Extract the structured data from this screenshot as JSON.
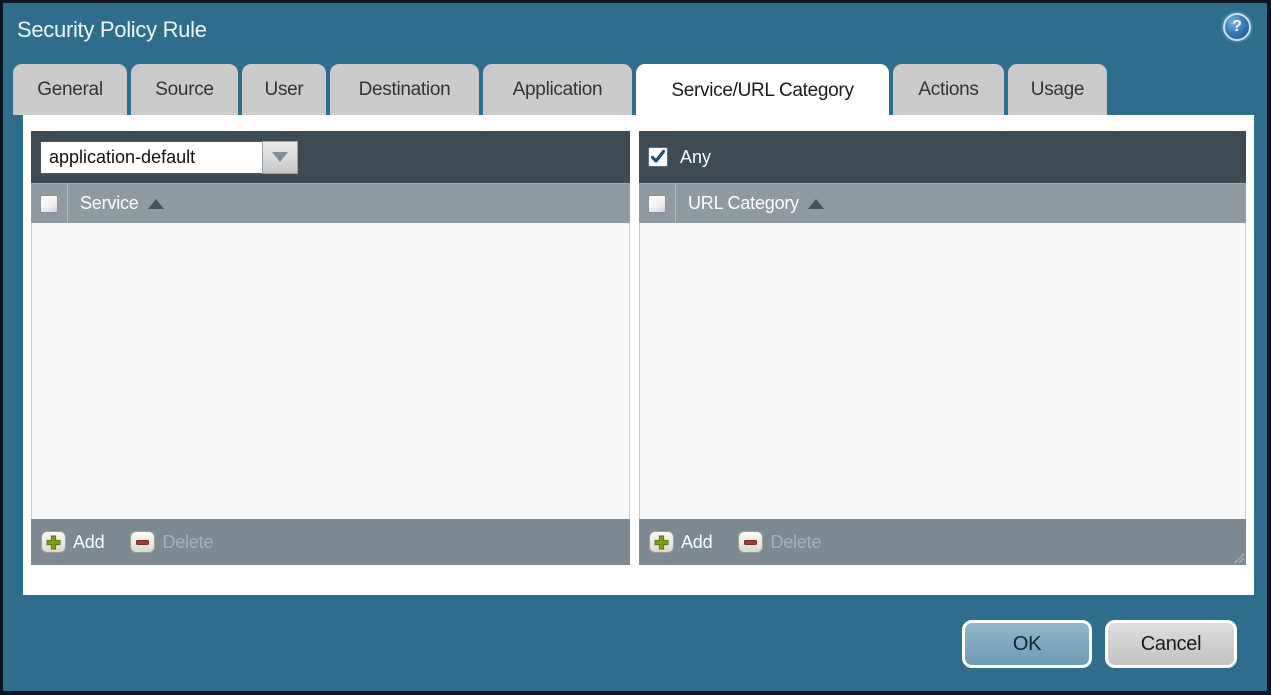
{
  "dialog": {
    "title": "Security Policy Rule"
  },
  "help": {
    "glyph": "?"
  },
  "tabs": [
    {
      "label": "General",
      "active": false
    },
    {
      "label": "Source",
      "active": false
    },
    {
      "label": "User",
      "active": false
    },
    {
      "label": "Destination",
      "active": false
    },
    {
      "label": "Application",
      "active": false
    },
    {
      "label": "Service/URL Category",
      "active": true
    },
    {
      "label": "Actions",
      "active": false
    },
    {
      "label": "Usage",
      "active": false
    }
  ],
  "service_panel": {
    "dropdown_value": "application-default",
    "column_header": "Service",
    "sort_direction": "ascending",
    "select_all_checked": false,
    "rows": [],
    "add_label": "Add",
    "delete_label": "Delete",
    "delete_enabled": false
  },
  "url_category_panel": {
    "any_label": "Any",
    "any_checked": true,
    "column_header": "URL Category",
    "sort_direction": "ascending",
    "select_all_checked": false,
    "rows": [],
    "add_label": "Add",
    "delete_label": "Delete",
    "delete_enabled": false
  },
  "footer": {
    "ok_label": "OK",
    "cancel_label": "Cancel"
  },
  "colors": {
    "dialog_background": "#2f6d8d",
    "outer_border": "#0c1520",
    "panel_header_dark": "#3e4b54",
    "column_header_gray": "#909aa1",
    "footer_bar_gray": "#7e8a93",
    "inactive_tab_gray": "#cbcbcb",
    "active_tab_white": "#ffffff",
    "ok_button_blue": "#7aa6bc",
    "cancel_button_gray": "#d0d0d0",
    "add_plus_green": "#7e9c14",
    "delete_minus_red": "#a23f31",
    "checkbox_check_blue": "#1e4f77",
    "help_icon_blue": "#2c6da4"
  }
}
